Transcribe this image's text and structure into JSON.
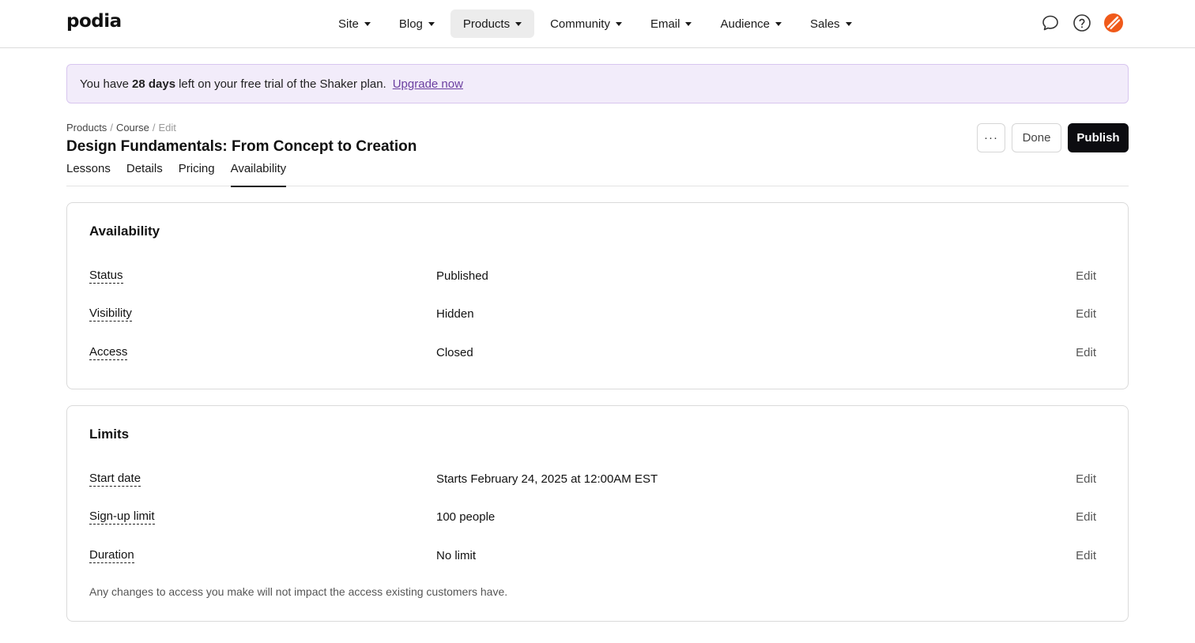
{
  "brand": {
    "logo_text": "podia",
    "accent": "#6b3fa0",
    "publish_bg": "#0c0c10",
    "avatar_color": "#f05a1a"
  },
  "nav": {
    "items": [
      {
        "label": "Site",
        "active": false
      },
      {
        "label": "Blog",
        "active": false
      },
      {
        "label": "Products",
        "active": true
      },
      {
        "label": "Community",
        "active": false
      },
      {
        "label": "Email",
        "active": false
      },
      {
        "label": "Audience",
        "active": false
      },
      {
        "label": "Sales",
        "active": false
      }
    ],
    "icons": [
      "chat-bubble-icon",
      "help-circle-icon",
      "account-avatar-icon"
    ]
  },
  "banner": {
    "prefix": "You have",
    "days": "28 days",
    "suffix": "left on your free trial of the Shaker plan.",
    "link": "Upgrade now"
  },
  "breadcrumb": {
    "products": "Products",
    "course": "Course",
    "current": "Edit",
    "separator": "/"
  },
  "page": {
    "title": "Design Fundamentals: From Concept to Creation",
    "more_label": "···",
    "done_label": "Done",
    "publish_label": "Publish"
  },
  "tabs": [
    {
      "label": "Lessons",
      "active": false
    },
    {
      "label": "Details",
      "active": false
    },
    {
      "label": "Pricing",
      "active": false
    },
    {
      "label": "Availability",
      "active": true
    }
  ],
  "availability": {
    "title": "Availability",
    "rows": [
      {
        "label": "Status",
        "value": "Published",
        "action": "Edit"
      },
      {
        "label": "Visibility",
        "value": "Hidden",
        "action": "Edit"
      },
      {
        "label": "Access",
        "value": "Closed",
        "action": "Edit"
      }
    ]
  },
  "limits": {
    "title": "Limits",
    "rows": [
      {
        "label": "Start date",
        "value": "Starts February 24, 2025 at 12:00AM EST",
        "action": "Edit"
      },
      {
        "label": "Sign-up limit",
        "value": "100 people",
        "action": "Edit"
      },
      {
        "label": "Duration",
        "value": "No limit",
        "action": "Edit"
      }
    ],
    "note": "Any changes to access you make will not impact the access existing customers have."
  }
}
